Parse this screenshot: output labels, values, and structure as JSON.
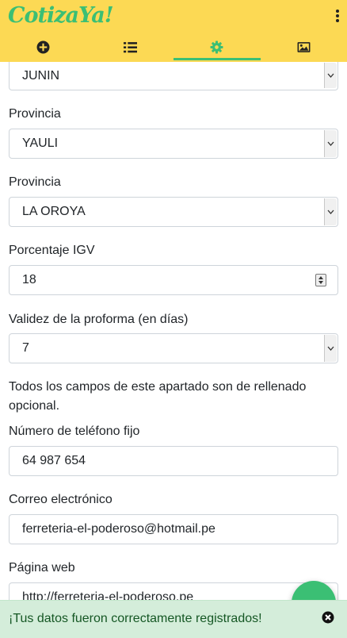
{
  "app": {
    "logo_text": "CotizaYa!",
    "accent": "#3bbf74",
    "bar_color": "#fcd954"
  },
  "tabs": [
    {
      "icon": "plus-circle-icon"
    },
    {
      "icon": "list-icon"
    },
    {
      "icon": "gear-icon",
      "active": true
    },
    {
      "icon": "image-icon"
    }
  ],
  "form": {
    "region_value": "JUNIN",
    "provincia_label": "Provincia",
    "provincia_value": "YAULI",
    "distrito_label": "Provincia",
    "distrito_value": "LA OROYA",
    "igv_label": "Porcentaje IGV",
    "igv_value": "18",
    "validez_label": "Validez de la proforma (en días)",
    "validez_value": "7",
    "optional_note": "Todos los campos de este apartado son de rellenado opcional.",
    "phone_label": "Número de teléfono fijo",
    "phone_value": "64 987 654",
    "email_label": "Correo electrónico",
    "email_value": "ferreteria-el-poderoso@hotmail.pe",
    "web_label": "Página web",
    "web_value": "http://ferreteria-el-poderoso.pe"
  },
  "toast": {
    "message": "¡Tus datos fueron correctamente registrados!",
    "color": "#d4edda"
  }
}
